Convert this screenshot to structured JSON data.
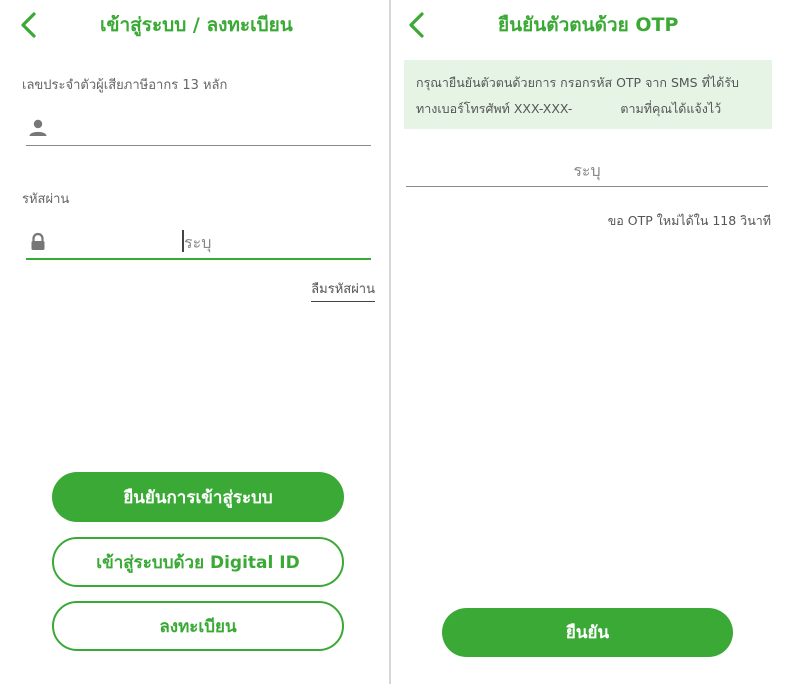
{
  "login": {
    "title": "เข้าสู่ระบบ / ลงทะเบียน",
    "id_label": "เลขประจำตัวผู้เสียภาษีอากร 13 หลัก",
    "password_label": "รหัสผ่าน",
    "password_placeholder": "ระบุ",
    "forgot_password": "ลืมรหัสผ่าน",
    "confirm_login_button": "ยืนยันการเข้าสู่ระบบ",
    "digital_id_button": "เข้าสู่ระบบด้วย Digital ID",
    "register_button": "ลงทะเบียน"
  },
  "otp": {
    "title": "ยืนยันตัวตนด้วย OTP",
    "notice_line1": "กรุณายืนยันตัวตนด้วยการ กรอกรหัส OTP จาก SMS ที่ได้รับ",
    "notice_line2": "ทางเบอร์โทรศัพท์ XXX-XXX-",
    "notice_line2_suffix": "ตามที่คุณได้แจ้งไว้",
    "otp_placeholder": "ระบุ",
    "resend_timer": "ขอ OTP ใหม่ได้ใน 118 วินาที",
    "confirm_button": "ยืนยัน"
  },
  "icons": {
    "back": "chevron-left-icon",
    "user": "user-icon",
    "lock": "lock-icon"
  },
  "colors": {
    "accent": "#3aa935",
    "notice_bg": "#e6f4e5"
  }
}
